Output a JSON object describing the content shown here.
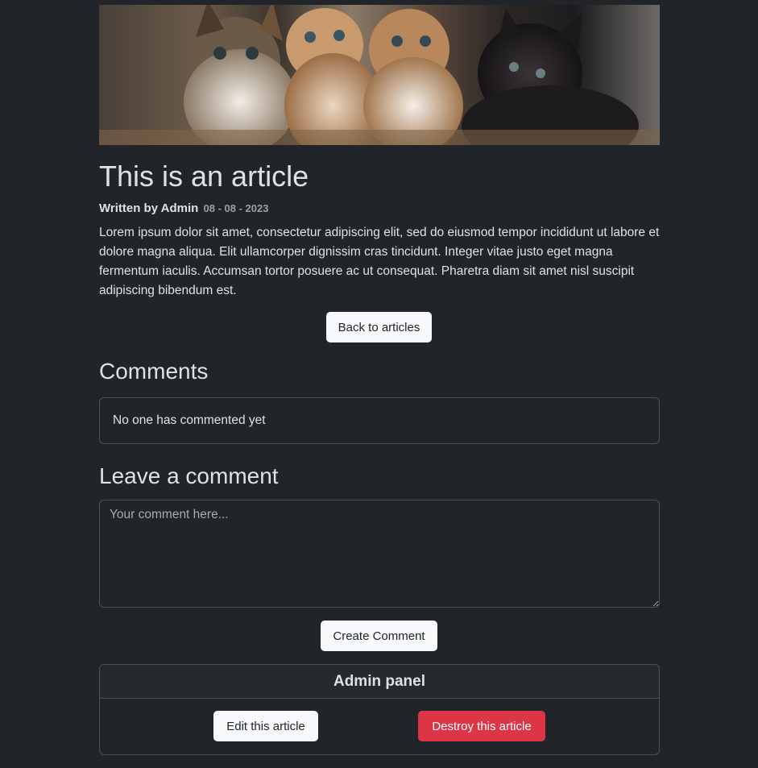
{
  "article": {
    "image_alt": "Four kittens",
    "title": "This is an article",
    "author": "Written by Admin",
    "date": "08 - 08 - 2023",
    "body": "Lorem ipsum dolor sit amet, consectetur adipiscing elit, sed do eiusmod tempor incididunt ut labore et dolore magna aliqua. Elit ullamcorper dignissim cras tincidunt. Integer vitae justo eget magna fermentum iaculis. Accumsan tortor posuere ac ut consequat. Pharetra diam sit amet nisl suscipit adipiscing bibendum est.",
    "back_label": "Back to articles"
  },
  "comments": {
    "heading": "Comments",
    "empty_text": "No one has commented yet"
  },
  "comment_form": {
    "heading": "Leave a comment",
    "placeholder": "Your comment here...",
    "value": "",
    "submit_label": "Create Comment"
  },
  "admin_panel": {
    "heading": "Admin panel",
    "edit_label": "Edit this article",
    "destroy_label": "Destroy this article"
  },
  "colors": {
    "background": "#212529",
    "text": "#dee2e6",
    "border": "#495057",
    "danger": "#dc3545",
    "light": "#f8f9fa"
  }
}
